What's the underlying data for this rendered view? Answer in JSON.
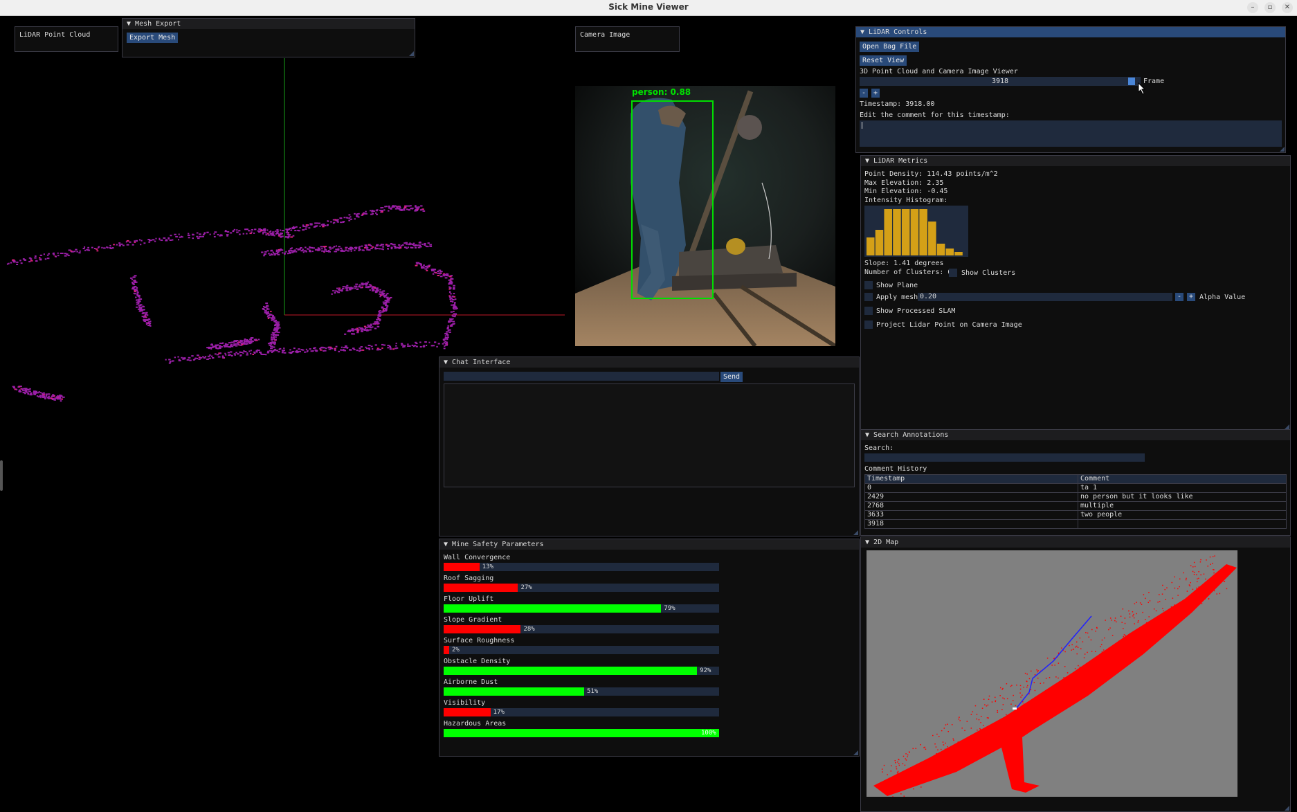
{
  "app": {
    "title": "Sick Mine Viewer"
  },
  "window_controls": {
    "minimize": "–",
    "maximize": "▫",
    "close": "✕"
  },
  "lidar_point_cloud": {
    "label": "LiDAR Point Cloud"
  },
  "mesh_export": {
    "title": "Mesh Export",
    "button": "Export Mesh"
  },
  "camera": {
    "label": "Camera Image",
    "detection_label": "person: 0.88"
  },
  "lidar_controls": {
    "title": "LiDAR Controls",
    "open_bag": "Open Bag File",
    "reset_view": "Reset View",
    "subtitle": "3D Point Cloud and Camera Image Viewer",
    "frame_value": "3918",
    "frame_label": "Frame",
    "frame_fraction": 0.98,
    "minus": "-",
    "plus": "+",
    "timestamp": "Timestamp: 3918.00",
    "comment_label": "Edit the comment for this timestamp:",
    "comment_value": ""
  },
  "lidar_metrics": {
    "title": "LiDAR Metrics",
    "point_density": "Point Density: 114.43 points/m^2",
    "max_elev": "Max Elevation: 2.35",
    "min_elev": "Min Elevation: -0.45",
    "hist_label": "Intensity Histogram:",
    "histogram": [
      0.38,
      0.55,
      0.98,
      0.98,
      0.98,
      0.98,
      0.98,
      0.72,
      0.25,
      0.15,
      0.07
    ],
    "hist_color": "#d4a017",
    "slope": "Slope: 1.41 degrees",
    "clusters": "Number of Clusters: 07",
    "show_clusters": "Show Clusters",
    "show_plane": "Show Plane",
    "apply_mesh": "Apply mesh",
    "alpha_value_num": "0.20",
    "alpha_label": "Alpha Value",
    "show_slam": "Show Processed SLAM",
    "project_lidar": "Project Lidar Point on Camera Image"
  },
  "chat": {
    "title": "Chat Interface",
    "send": "Send",
    "input_value": ""
  },
  "search": {
    "title": "Search Annotations",
    "search_label": "Search:",
    "history_label": "Comment History",
    "col_timestamp": "Timestamp",
    "col_comment": "Comment",
    "rows": [
      {
        "ts": "0",
        "comment": "ta 1"
      },
      {
        "ts": "2429",
        "comment": "no person but it looks like"
      },
      {
        "ts": "2768",
        "comment": "multiple"
      },
      {
        "ts": "3633",
        "comment": "two people"
      },
      {
        "ts": "3918",
        "comment": ""
      }
    ]
  },
  "safety": {
    "title": "Mine Safety Parameters",
    "params": [
      {
        "name": "Wall Convergence",
        "value": 13,
        "label": "13%",
        "status": "red"
      },
      {
        "name": "Roof Sagging",
        "value": 27,
        "label": "27%",
        "status": "red"
      },
      {
        "name": "Floor Uplift",
        "value": 79,
        "label": "79%",
        "status": "green"
      },
      {
        "name": "Slope Gradient",
        "value": 28,
        "label": "28%",
        "status": "red"
      },
      {
        "name": "Surface Roughness",
        "value": 2,
        "label": "2%",
        "status": "red"
      },
      {
        "name": "Obstacle Density",
        "value": 92,
        "label": "92%",
        "status": "green"
      },
      {
        "name": "Airborne Dust",
        "value": 51,
        "label": "51%",
        "status": "green"
      },
      {
        "name": "Visibility",
        "value": 17,
        "label": "17%",
        "status": "red"
      },
      {
        "name": "Hazardous Areas",
        "value": 100,
        "label": "100%",
        "status": "green"
      }
    ],
    "colors": {
      "red": "#ff0000",
      "green": "#00ff00"
    }
  },
  "map2d": {
    "title": "2D Map"
  },
  "colors": {
    "accent": "#294a7a",
    "panel": "#0f0f0f",
    "frame": "#1f2a3d",
    "point_cloud": "#9b1fa8",
    "map_bg": "#808080",
    "map_points": "#ff0000"
  }
}
